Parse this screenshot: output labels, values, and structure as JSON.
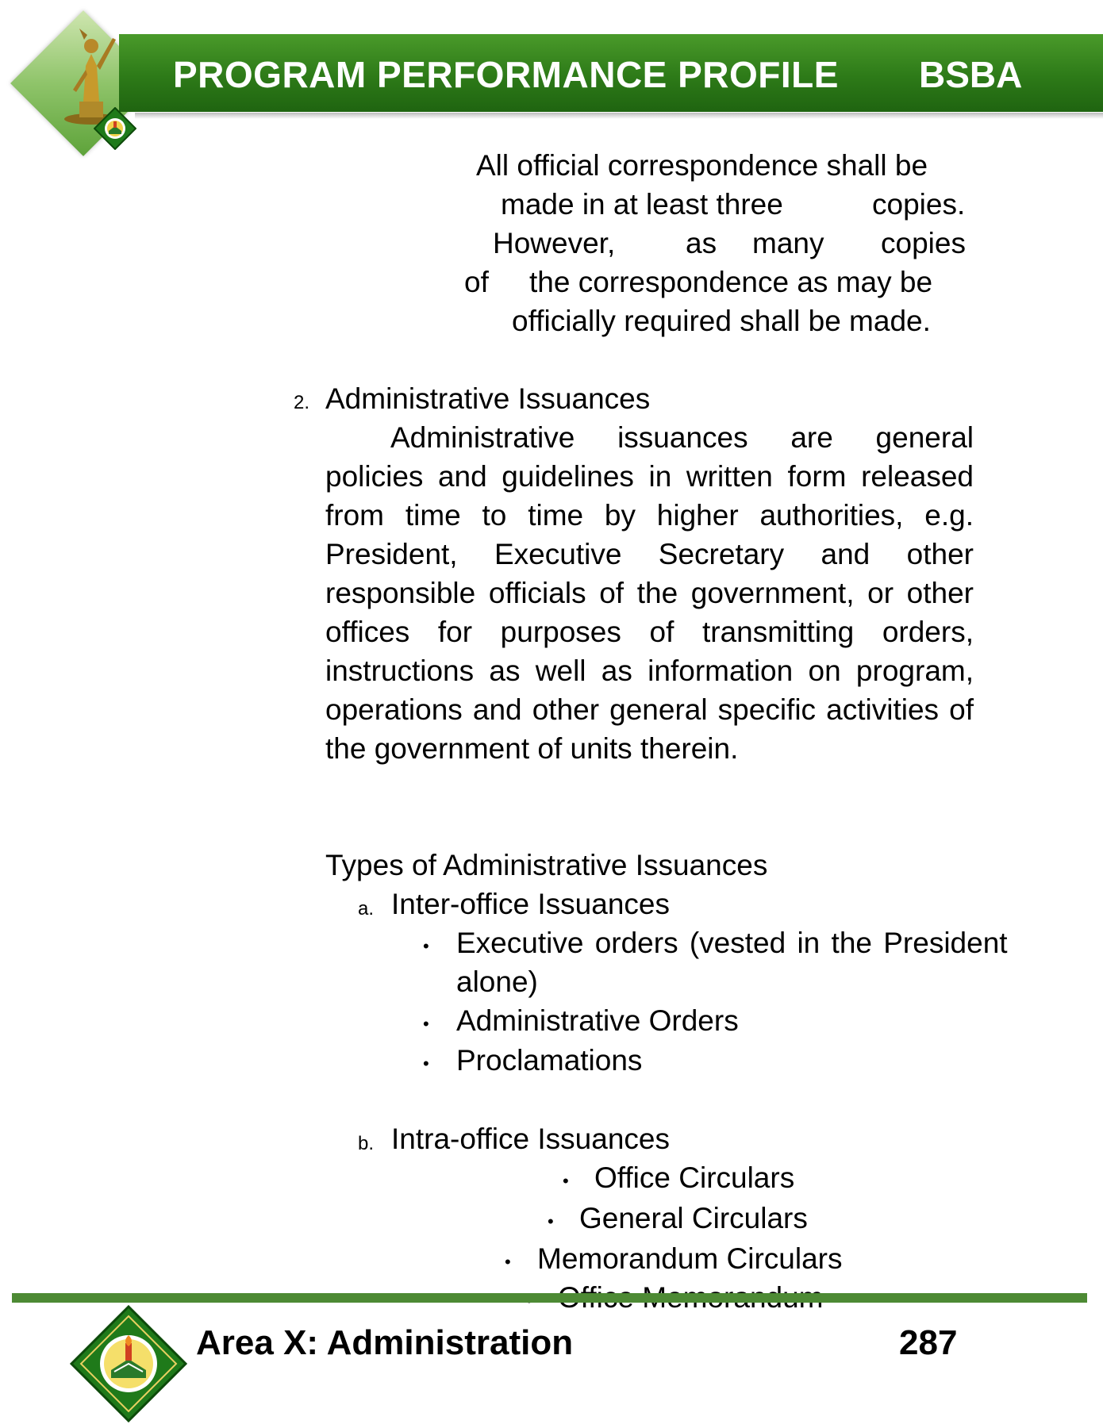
{
  "header": {
    "title": "PROGRAM PERFORMANCE PROFILE",
    "program_code": "BSBA"
  },
  "intro": {
    "lines": [
      "All official correspondence shall be",
      "made in at least three",
      "copies.",
      "However,",
      "as",
      "many",
      "copies",
      "of",
      "the correspondence as may be",
      "officially required shall be made."
    ]
  },
  "section2": {
    "number": "2.",
    "heading": "Administrative Issuances",
    "paragraph": "Administrative issuances are general policies and guidelines in written form released from time to time by higher authorities, e.g. President, Executive Secretary and other responsible officials of the government, or other offices for purposes of transmitting orders, instructions as well as information on program, operations and other general specific activities of the government of units therein.",
    "types_heading": "Types of Administrative Issuances",
    "group_a": {
      "marker": "a.",
      "label": "Inter-office Issuances",
      "items": [
        "Executive orders (vested in the President",
        "alone)",
        "Administrative Orders",
        "Proclamations"
      ]
    },
    "group_b": {
      "marker": "b.",
      "label": "Intra-office Issuances",
      "items": [
        "Office Circulars",
        "General Circulars",
        "Memorandum Circulars",
        "Office Memorandum"
      ]
    }
  },
  "footer": {
    "title": "Area X: Administration",
    "page_number": "287"
  },
  "colors": {
    "header_green": "#2d7a18",
    "footer_line_green": "#4d8a34"
  },
  "icons": {
    "header_logo": "statue-logo-icon",
    "header_seal": "university-seal-icon",
    "footer_seal": "university-seal-icon"
  }
}
